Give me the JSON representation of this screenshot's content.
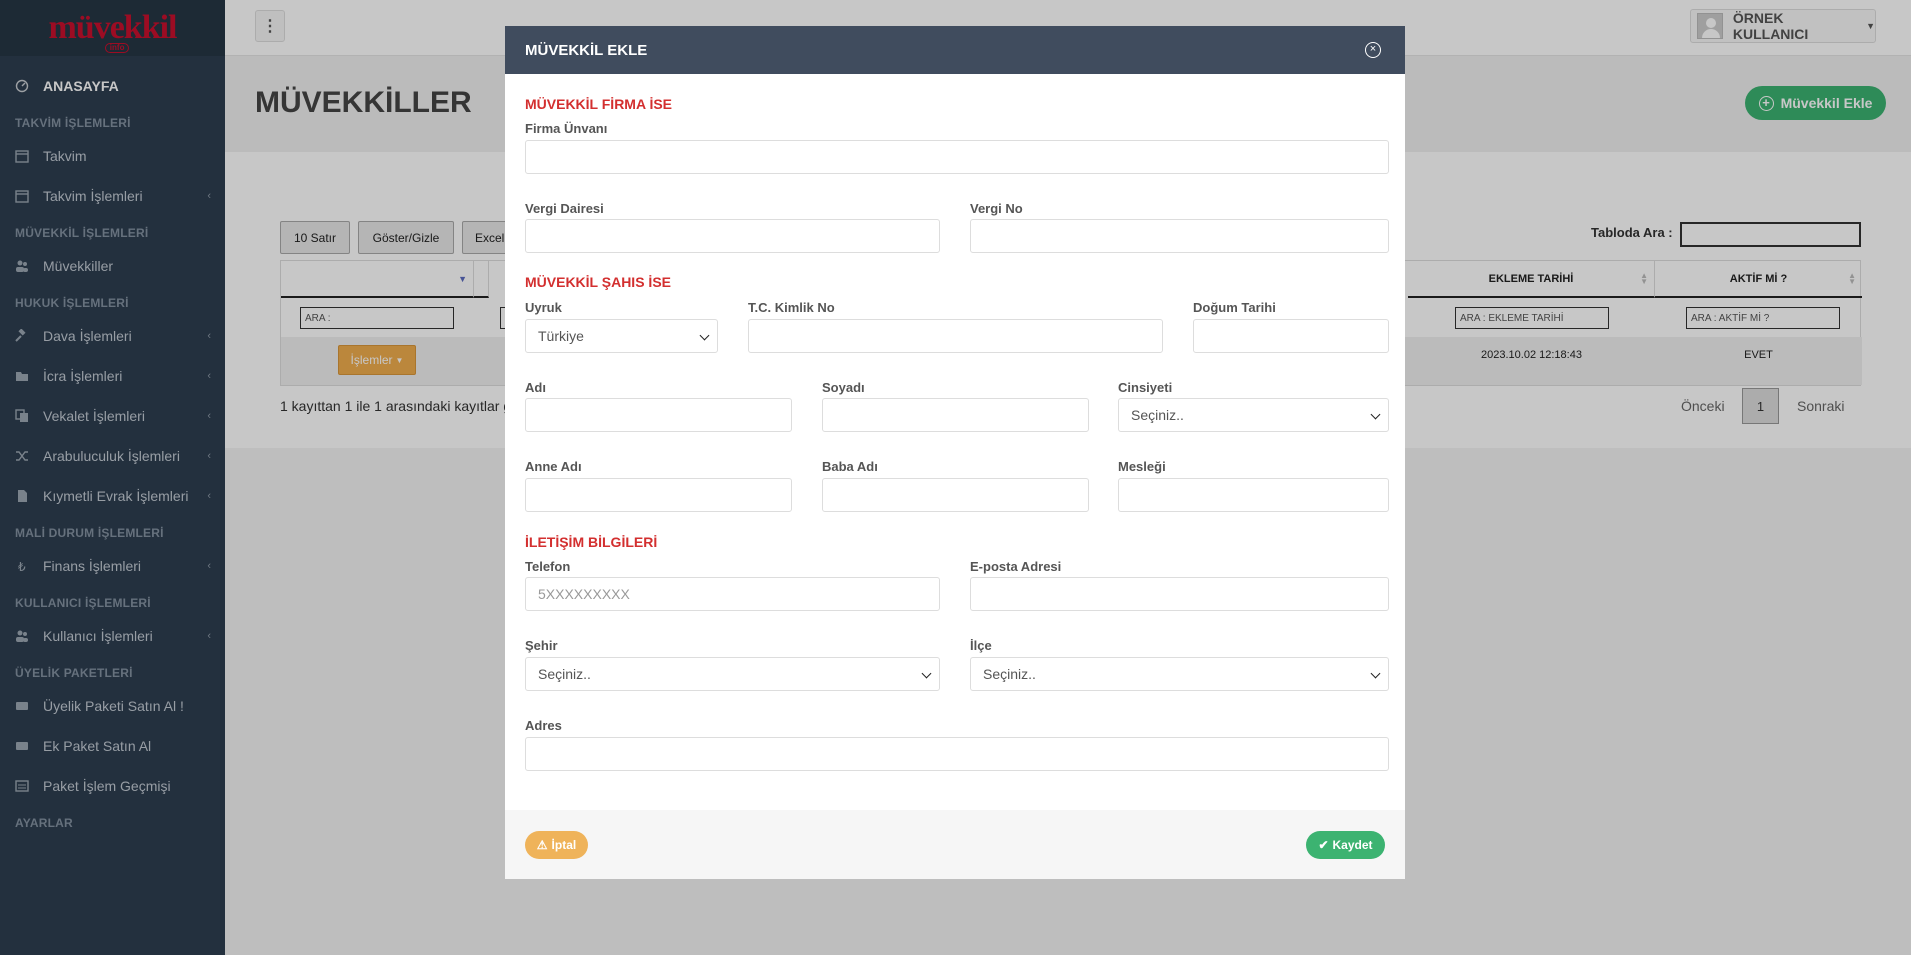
{
  "logo": {
    "text": "müvekkil",
    "sub": "info"
  },
  "sidebar": {
    "home": "ANASAYFA",
    "sections": [
      {
        "title": "TAKVİM İŞLEMLERİ",
        "items": [
          {
            "label": "Takvim",
            "icon": "calendar-icon",
            "sub": false
          },
          {
            "label": "Takvim İşlemleri",
            "icon": "calendar-icon",
            "sub": true
          }
        ]
      },
      {
        "title": "MÜVEKKİL İŞLEMLERİ",
        "items": [
          {
            "label": "Müvekkiller",
            "icon": "users-icon",
            "sub": false
          }
        ]
      },
      {
        "title": "HUKUK İŞLEMLERİ",
        "items": [
          {
            "label": "Dava İşlemleri",
            "icon": "gavel-icon",
            "sub": true
          },
          {
            "label": "İcra İşlemleri",
            "icon": "folder-icon",
            "sub": true
          },
          {
            "label": "Vekalet İşlemleri",
            "icon": "copy-icon",
            "sub": true
          },
          {
            "label": "Arabuluculuk İşlemleri",
            "icon": "shuffle-icon",
            "sub": true
          },
          {
            "label": "Kıymetli Evrak İşlemleri",
            "icon": "file-icon",
            "sub": true
          }
        ]
      },
      {
        "title": "MALİ DURUM İŞLEMLERİ",
        "items": [
          {
            "label": "Finans İşlemleri",
            "icon": "lira-icon",
            "sub": true
          }
        ]
      },
      {
        "title": "KULLANICI İŞLEMLERİ",
        "items": [
          {
            "label": "Kullanıcı İşlemleri",
            "icon": "users-icon",
            "sub": true
          }
        ]
      },
      {
        "title": "ÜYELİK PAKETLERİ",
        "items": [
          {
            "label": "Üyelik Paketi Satın Al !",
            "icon": "keyboard-icon",
            "sub": false
          },
          {
            "label": "Ek Paket Satın Al",
            "icon": "keyboard-icon",
            "sub": false
          },
          {
            "label": "Paket İşlem Geçmişi",
            "icon": "list-icon",
            "sub": false
          }
        ]
      },
      {
        "title": "AYARLAR",
        "items": []
      }
    ]
  },
  "header": {
    "user": "ÖRNEK KULLANICI"
  },
  "page": {
    "title": "MÜVEKKİLLER",
    "add_button": "Müvekkil Ekle",
    "toolbar": {
      "rows": "10 Satır",
      "toggle": "Göster/Gizle",
      "excel": "Excel"
    },
    "search_label": "Tabloda Ara :",
    "table": {
      "headers": {
        "added": "EKLEME TARİHİ",
        "active": "AKTİF Mİ ?"
      },
      "filters": {
        "first": "ARA :",
        "added": "ARA : EKLEME TARİHİ",
        "active": "ARA : AKTİF Mİ ?"
      },
      "row": {
        "actions": "İşlemler",
        "added": "2023.10.02 12:18:43",
        "active": "EVET"
      }
    },
    "info": "1 kayıttan 1 ile 1 arasındaki kayıtlar g",
    "pager": {
      "prev": "Önceki",
      "current": "1",
      "next": "Sonraki"
    }
  },
  "modal": {
    "title": "MÜVEKKİL EKLE",
    "firm_section": "MÜVEKKİL FİRMA İSE",
    "person_section": "MÜVEKKİL ŞAHIS İSE",
    "contact_section": "İLETİŞİM BİLGİLERİ",
    "labels": {
      "firma_unvani": "Firma Ünvanı",
      "vergi_dairesi": "Vergi Dairesi",
      "vergi_no": "Vergi No",
      "uyruk": "Uyruk",
      "tc": "T.C. Kimlik No",
      "dogum": "Doğum Tarihi",
      "adi": "Adı",
      "soyadi": "Soyadı",
      "cinsiyet": "Cinsiyeti",
      "anne": "Anne Adı",
      "baba": "Baba Adı",
      "meslek": "Mesleği",
      "telefon": "Telefon",
      "eposta": "E-posta Adresi",
      "sehir": "Şehir",
      "ilce": "İlçe",
      "adres": "Adres"
    },
    "values": {
      "uyruk": "Türkiye",
      "cinsiyet": "Seçiniz..",
      "sehir": "Seçiniz..",
      "ilce": "Seçiniz.."
    },
    "placeholders": {
      "telefon": "5XXXXXXXXX"
    },
    "cancel": "İptal",
    "save": "Kaydet"
  }
}
